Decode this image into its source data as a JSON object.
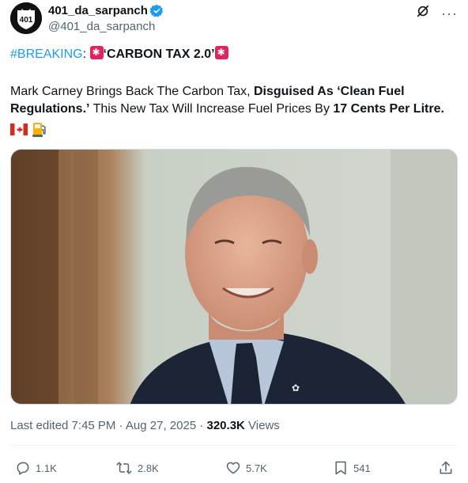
{
  "user": {
    "avatar_text": "401",
    "display_name": "401_da_sarpanch",
    "handle": "@401_da_sarpanch",
    "verified": true
  },
  "top_actions": {
    "grok_icon": "grok-icon",
    "more_label": "···"
  },
  "tweet": {
    "hashtag": "#BREAKING",
    "colon": ":",
    "headline": "‘CARBON TAX 2.0’",
    "text_plain_1": "Mark Carney Brings Back The Carbon Tax, ",
    "text_bold_1": "Disguised As ‘Clean Fuel Regulations.’",
    "text_plain_2": " This New Tax Will Increase Fuel Prices By ",
    "text_bold_2": "17 Cents Per Litre.",
    "emojis": [
      "canada-flag",
      "fuel-pump"
    ]
  },
  "meta": {
    "edited": "Last edited 7:45 PM · Aug 27, 2025 · ",
    "views_count": "320.3K",
    "views_label": " Views"
  },
  "actions": {
    "replies": "1.1K",
    "reposts": "2.8K",
    "likes": "5.7K",
    "bookmarks": "541"
  },
  "colors": {
    "text": "#0f1419",
    "secondary": "#536471",
    "link": "#1d9bf0",
    "siren": "#e0245e"
  }
}
